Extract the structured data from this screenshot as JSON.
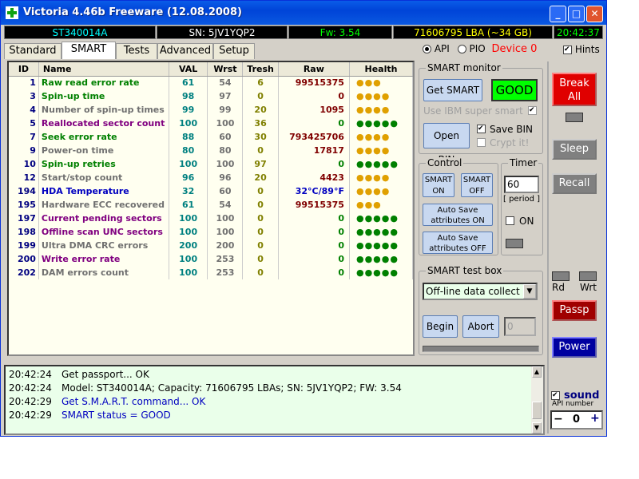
{
  "window": {
    "title": "Victoria 4.46b Freeware (12.08.2008)"
  },
  "status": {
    "model": "ST340014A",
    "serial": "SN: 5JV1YQP2",
    "firmware": "Fw: 3.54",
    "capacity": "71606795 LBA (~34 GB)",
    "time": "20:42:37"
  },
  "tabs": [
    "Standard",
    "SMART",
    "Tests",
    "Advanced",
    "Setup"
  ],
  "mode": {
    "api": "API",
    "pio": "PIO",
    "device": "Device 0",
    "hints": "Hints"
  },
  "smart_table": {
    "headers": [
      "ID",
      "Name",
      "VAL",
      "Wrst",
      "Tresh",
      "Raw",
      "Health"
    ],
    "rows": [
      {
        "id": "1",
        "name": "Raw read error rate",
        "val": "61",
        "wrst": "54",
        "tresh": "6",
        "raw": "99515375",
        "health": "●●●",
        "name_color": "#008000",
        "raw_color": "#800000",
        "health_color": "#e0a000"
      },
      {
        "id": "3",
        "name": "Spin-up time",
        "val": "98",
        "wrst": "97",
        "tresh": "0",
        "raw": "0",
        "health": "●●●●",
        "name_color": "#008000",
        "raw_color": "#800000",
        "health_color": "#e0a000"
      },
      {
        "id": "4",
        "name": "Number of spin-up times",
        "val": "99",
        "wrst": "99",
        "tresh": "20",
        "raw": "1095",
        "health": "●●●●",
        "name_color": "#707070",
        "raw_color": "#800000",
        "health_color": "#e0a000"
      },
      {
        "id": "5",
        "name": "Reallocated sector count",
        "val": "100",
        "wrst": "100",
        "tresh": "36",
        "raw": "0",
        "health": "●●●●●",
        "name_color": "#800080",
        "raw_color": "#008000",
        "health_color": "#008000"
      },
      {
        "id": "7",
        "name": "Seek error rate",
        "val": "88",
        "wrst": "60",
        "tresh": "30",
        "raw": "793425706",
        "health": "●●●●",
        "name_color": "#008000",
        "raw_color": "#800000",
        "health_color": "#e0a000"
      },
      {
        "id": "9",
        "name": "Power-on time",
        "val": "80",
        "wrst": "80",
        "tresh": "0",
        "raw": "17817",
        "health": "●●●●",
        "name_color": "#707070",
        "raw_color": "#800000",
        "health_color": "#e0a000"
      },
      {
        "id": "10",
        "name": "Spin-up retries",
        "val": "100",
        "wrst": "100",
        "tresh": "97",
        "raw": "0",
        "health": "●●●●●",
        "name_color": "#008000",
        "raw_color": "#008000",
        "health_color": "#008000"
      },
      {
        "id": "12",
        "name": "Start/stop count",
        "val": "96",
        "wrst": "96",
        "tresh": "20",
        "raw": "4423",
        "health": "●●●●",
        "name_color": "#707070",
        "raw_color": "#800000",
        "health_color": "#e0a000"
      },
      {
        "id": "194",
        "name": "HDA Temperature",
        "val": "32",
        "wrst": "60",
        "tresh": "0",
        "raw": "32°C/89°F",
        "health": "●●●●",
        "name_color": "#0000c0",
        "raw_color": "#0000c0",
        "health_color": "#e0a000"
      },
      {
        "id": "195",
        "name": "Hardware ECC recovered",
        "val": "61",
        "wrst": "54",
        "tresh": "0",
        "raw": "99515375",
        "health": "●●●",
        "name_color": "#707070",
        "raw_color": "#800000",
        "health_color": "#e0a000"
      },
      {
        "id": "197",
        "name": "Current pending sectors",
        "val": "100",
        "wrst": "100",
        "tresh": "0",
        "raw": "0",
        "health": "●●●●●",
        "name_color": "#800080",
        "raw_color": "#008000",
        "health_color": "#008000"
      },
      {
        "id": "198",
        "name": "Offline scan UNC sectors",
        "val": "100",
        "wrst": "100",
        "tresh": "0",
        "raw": "0",
        "health": "●●●●●",
        "name_color": "#800080",
        "raw_color": "#008000",
        "health_color": "#008000"
      },
      {
        "id": "199",
        "name": "Ultra DMA CRC errors",
        "val": "200",
        "wrst": "200",
        "tresh": "0",
        "raw": "0",
        "health": "●●●●●",
        "name_color": "#707070",
        "raw_color": "#008000",
        "health_color": "#008000"
      },
      {
        "id": "200",
        "name": "Write error rate",
        "val": "100",
        "wrst": "253",
        "tresh": "0",
        "raw": "0",
        "health": "●●●●●",
        "name_color": "#800080",
        "raw_color": "#008000",
        "health_color": "#008000"
      },
      {
        "id": "202",
        "name": "DAM errors count",
        "val": "100",
        "wrst": "253",
        "tresh": "0",
        "raw": "0",
        "health": "●●●●●",
        "name_color": "#707070",
        "raw_color": "#008000",
        "health_color": "#008000"
      }
    ]
  },
  "smart_monitor": {
    "title": "SMART monitor",
    "get_smart": "Get SMART",
    "status": "GOOD",
    "ibm": "Use IBM super smart",
    "open_bin": "Open BIN",
    "save_bin": "Save BIN",
    "crypt": "Crypt it!"
  },
  "control": {
    "title": "Control",
    "smart_on": "SMART ON",
    "smart_off": "SMART OFF",
    "autosave_on": "Auto Save attributes ON",
    "autosave_off": "Auto Save attributes OFF"
  },
  "timer": {
    "title": "Timer",
    "value": "60",
    "period": "[ period ]",
    "on": "ON"
  },
  "test_box": {
    "title": "SMART test box",
    "selected": "Off-line data collect",
    "begin": "Begin",
    "abort": "Abort",
    "counter": "0"
  },
  "side": {
    "break_all": "Break All",
    "sleep": "Sleep",
    "recall": "Recall",
    "rd": "Rd",
    "wrt": "Wrt",
    "passp": "Passp",
    "power": "Power",
    "sound": "sound",
    "api_number": "API number",
    "api_value": "0"
  },
  "log": [
    {
      "time": "20:42:24",
      "text": "Get passport... OK",
      "color": "#000000"
    },
    {
      "time": "20:42:24",
      "text": "Model: ST340014A; Capacity: 71606795 LBAs; SN: 5JV1YQP2; FW: 3.54",
      "color": "#000000"
    },
    {
      "time": "20:42:29",
      "text": "Get S.M.A.R.T. command... OK",
      "color": "#0000c0"
    },
    {
      "time": "20:42:29",
      "text": "SMART status = GOOD",
      "color": "#0000c0"
    }
  ]
}
